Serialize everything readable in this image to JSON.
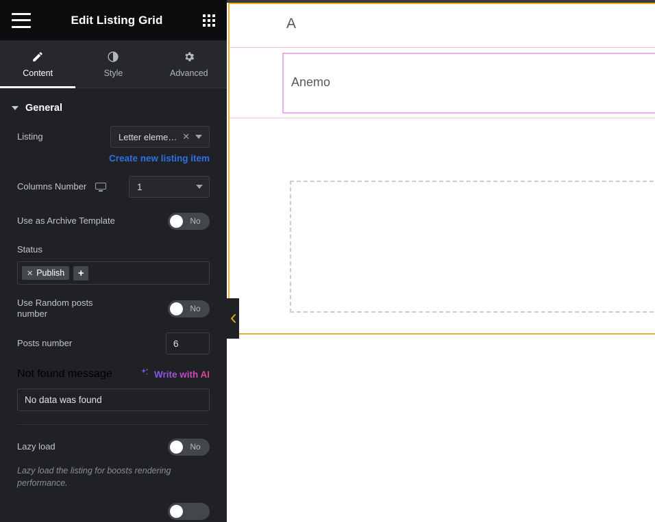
{
  "panel": {
    "header": {
      "title": "Edit Listing Grid",
      "menu_icon": "hamburger-menu-icon",
      "apps_icon": "apps-grid-icon"
    },
    "tabs": [
      {
        "label": "Content",
        "icon": "pencil-icon",
        "active": true
      },
      {
        "label": "Style",
        "icon": "contrast-circle-icon",
        "active": false
      },
      {
        "label": "Advanced",
        "icon": "gear-icon",
        "active": false
      }
    ],
    "section": {
      "title": "General",
      "collapse_icon": "caret-down-icon"
    },
    "controls": {
      "listing": {
        "label": "Listing",
        "value": "Letter eleme…",
        "clear_icon": "close-x-icon",
        "dropdown_icon": "chevron-down-icon"
      },
      "create_listing_link": "Create new listing item",
      "columns_number": {
        "label": "Columns Number",
        "device_icon": "desktop-monitor-icon",
        "value": "1",
        "dropdown_icon": "chevron-down-icon"
      },
      "use_as_archive_template": {
        "label": "Use as Archive Template",
        "value": "No"
      },
      "status": {
        "label": "Status",
        "chips": [
          {
            "label": "Publish",
            "remove_icon": "close-x-icon"
          }
        ],
        "add_label": "+"
      },
      "use_random_posts_number": {
        "label": "Use Random posts number",
        "value": "No"
      },
      "posts_number": {
        "label": "Posts number",
        "value": "6"
      },
      "not_found_message": {
        "label": "Not found message",
        "ai_button_label": "Write with AI",
        "ai_icon": "sparkles-icon",
        "value": "No data was found"
      },
      "lazy_load": {
        "label": "Lazy load",
        "value": "No",
        "helper": "Lazy load the listing for boosts rendering performance."
      }
    }
  },
  "canvas": {
    "heading_text": "A",
    "listing_item_text": "Anemo",
    "collapse_handle_icon": "chevron-left-icon",
    "colors": {
      "section_outline": "#f5ab2b",
      "widget_outline": "#f0aaf0",
      "placeholder_outline": "#c9ccd1"
    }
  }
}
